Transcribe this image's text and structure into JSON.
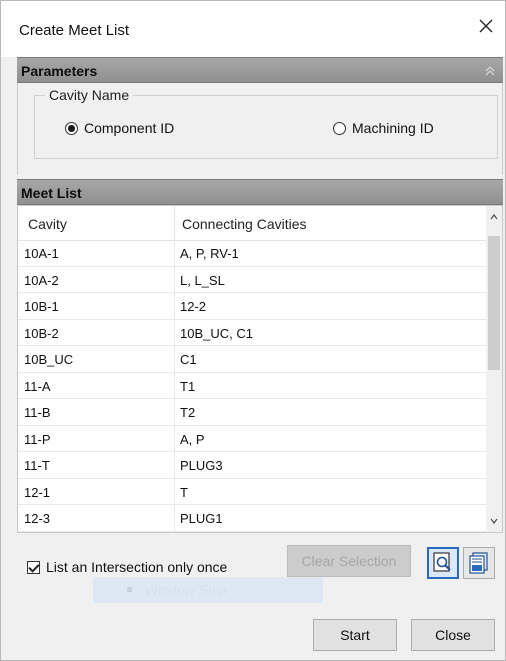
{
  "window": {
    "title": "Create Meet List"
  },
  "parameters": {
    "header": "Parameters",
    "group_label": "Cavity Name",
    "options": [
      {
        "label": "Component ID",
        "checked": true
      },
      {
        "label": "Machining ID",
        "checked": false
      }
    ]
  },
  "meet_list": {
    "header": "Meet List",
    "columns": [
      "Cavity",
      "Connecting Cavities"
    ],
    "rows": [
      {
        "cavity": "10A-1",
        "connecting": "A, P, RV-1"
      },
      {
        "cavity": "10A-2",
        "connecting": "L, L_SL"
      },
      {
        "cavity": "10B-1",
        "connecting": "12-2"
      },
      {
        "cavity": "10B-2",
        "connecting": "10B_UC, C1"
      },
      {
        "cavity": "10B_UC",
        "connecting": "C1"
      },
      {
        "cavity": "11-A",
        "connecting": "T1"
      },
      {
        "cavity": "11-B",
        "connecting": "T2"
      },
      {
        "cavity": "11-P",
        "connecting": "A, P"
      },
      {
        "cavity": "11-T",
        "connecting": "PLUG3"
      },
      {
        "cavity": "12-1",
        "connecting": "T"
      },
      {
        "cavity": "12-3",
        "connecting": "PLUG1"
      }
    ]
  },
  "options": {
    "list_once_label": "List an Intersection only once",
    "list_once_checked": true
  },
  "buttons": {
    "clear_selection": "Clear Selection",
    "start": "Start",
    "close": "Close"
  },
  "overlay": {
    "window_snip_label": "Window Snip"
  },
  "colors": {
    "section_header": "#9a9a9a",
    "active_icon_border": "#2a6bbf"
  }
}
